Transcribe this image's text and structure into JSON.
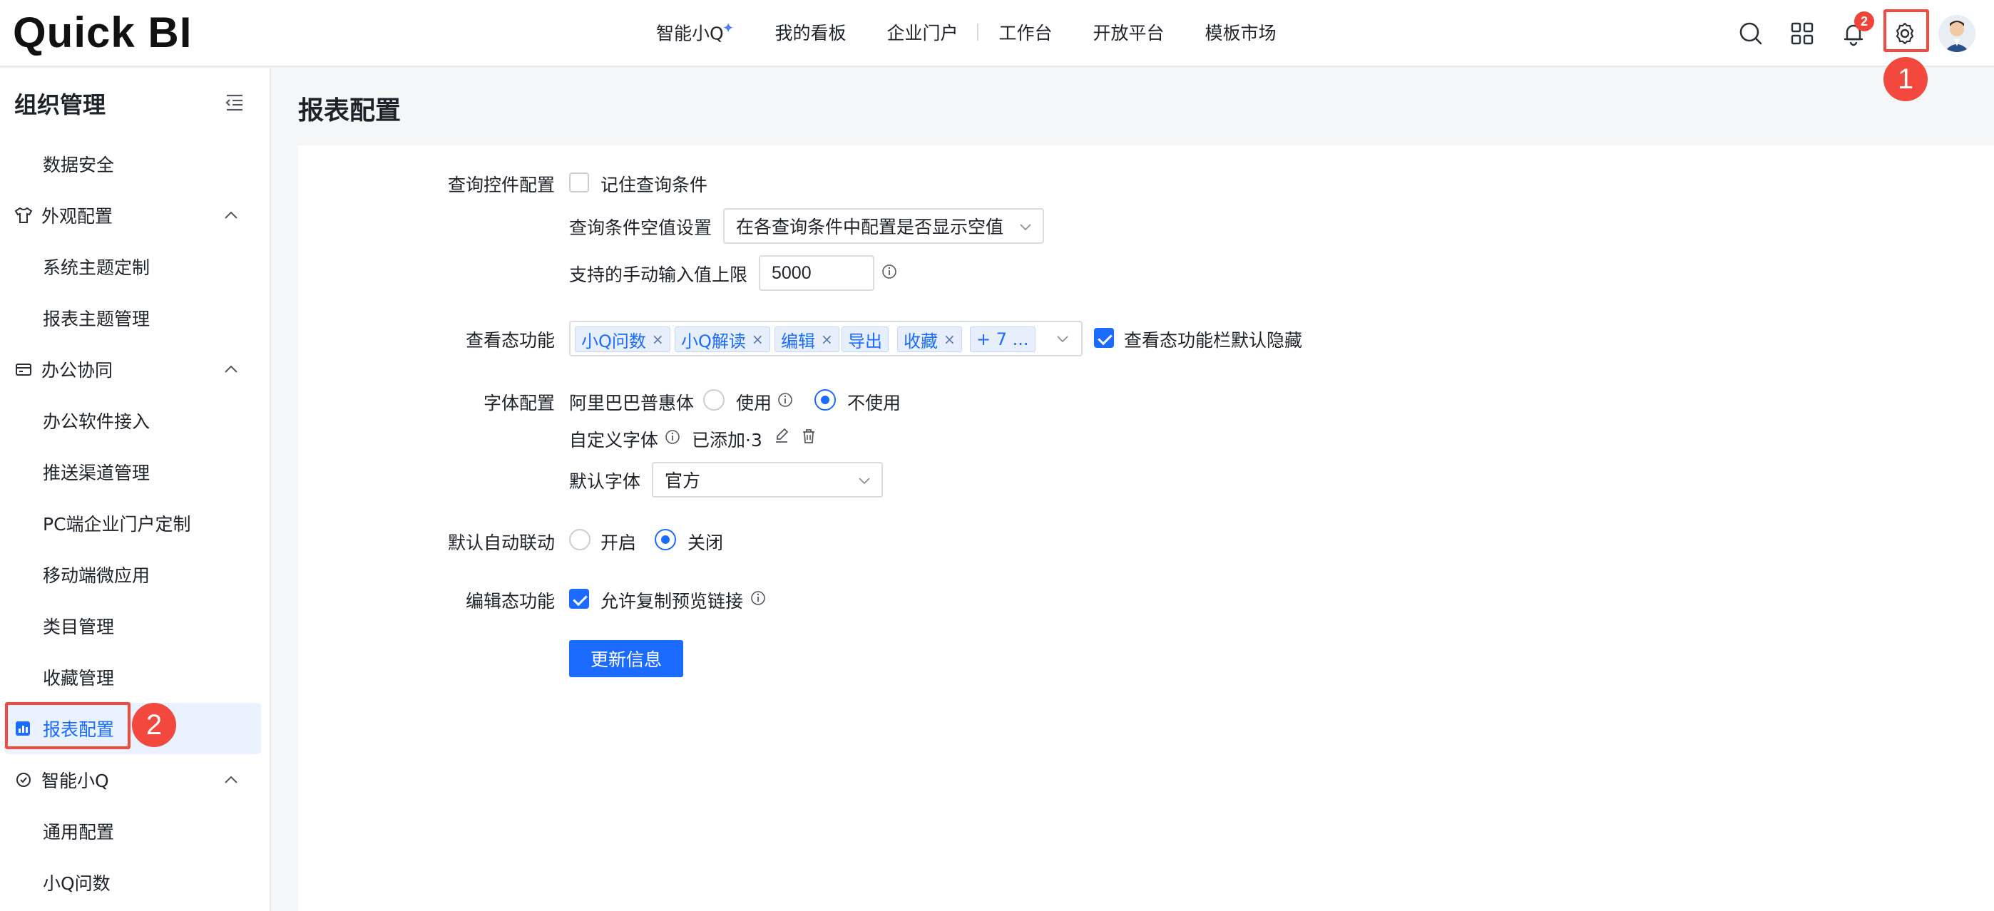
{
  "app": {
    "logo": "Quick BI"
  },
  "topnav": {
    "items": [
      {
        "label": "智能小Q"
      },
      {
        "label": "我的看板"
      },
      {
        "label": "企业门户"
      },
      {
        "label": "工作台"
      },
      {
        "label": "开放平台"
      },
      {
        "label": "模板市场"
      }
    ],
    "notification_count": "2",
    "annotation_1": "1"
  },
  "sidebar": {
    "title": "组织管理",
    "items": [
      {
        "label": "数据安全"
      },
      {
        "label": "外观配置"
      },
      {
        "label": "系统主题定制"
      },
      {
        "label": "报表主题管理"
      },
      {
        "label": "办公协同"
      },
      {
        "label": "办公软件接入"
      },
      {
        "label": "推送渠道管理"
      },
      {
        "label": "PC端企业门户定制"
      },
      {
        "label": "移动端微应用"
      },
      {
        "label": "类目管理"
      },
      {
        "label": "收藏管理"
      },
      {
        "label": "报表配置"
      },
      {
        "label": "智能小Q"
      },
      {
        "label": "通用配置"
      },
      {
        "label": "小Q问数"
      }
    ],
    "annotation_2": "2"
  },
  "page": {
    "title": "报表配置",
    "query_control": {
      "label": "查询控件配置",
      "remember_label": "记住查询条件",
      "remember_checked": false,
      "null_setting_label": "查询条件空值设置",
      "null_setting_value": "在各查询条件中配置是否显示空值",
      "manual_limit_label": "支持的手动输入值上限",
      "manual_limit_value": "5000"
    },
    "view_mode": {
      "label": "查看态功能",
      "tags": [
        "小Q问数",
        "小Q解读",
        "编辑",
        "导出",
        "收藏"
      ],
      "more_tag": "+ 7 ...",
      "default_hide_label": "查看态功能栏默认隐藏",
      "default_hide_checked": true
    },
    "font": {
      "label": "字体配置",
      "alibaba_label": "阿里巴巴普惠体",
      "use_label": "使用",
      "not_use_label": "不使用",
      "selected": "不使用",
      "custom_label": "自定义字体",
      "custom_added": "已添加·3",
      "default_label": "默认字体",
      "default_value": "官方"
    },
    "auto_link": {
      "label": "默认自动联动",
      "on_label": "开启",
      "off_label": "关闭",
      "selected": "关闭"
    },
    "edit_mode": {
      "label": "编辑态功能",
      "allow_copy_label": "允许复制预览链接",
      "allow_copy_checked": true
    },
    "update_button": "更新信息"
  },
  "colors": {
    "primary": "#1b6bff",
    "annotation_red": "#f2483d",
    "active_bg": "#eaf1ff"
  }
}
